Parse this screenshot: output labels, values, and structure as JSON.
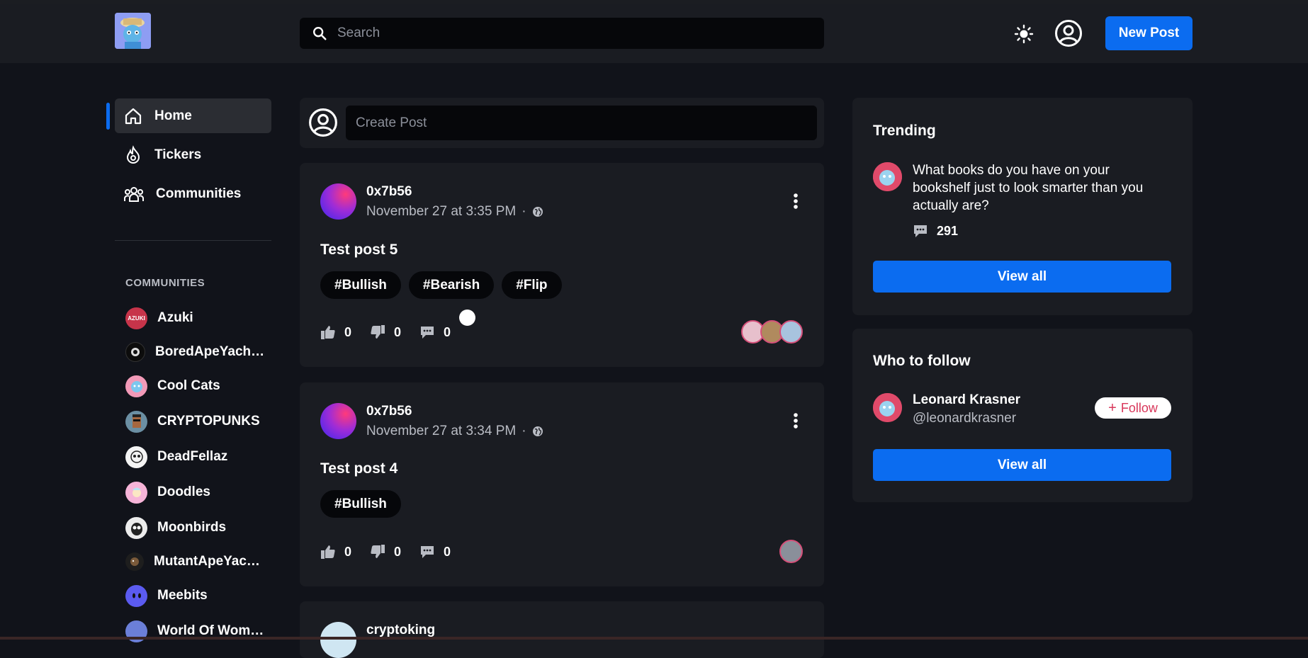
{
  "header": {
    "search_placeholder": "Search",
    "new_post_label": "New Post"
  },
  "nav": {
    "items": [
      {
        "label": "Home",
        "icon": "home-icon",
        "active": true
      },
      {
        "label": "Tickers",
        "icon": "fire-icon"
      },
      {
        "label": "Communities",
        "icon": "people-icon"
      }
    ],
    "communities_heading": "COMMUNITIES",
    "communities": [
      {
        "label": "Azuki",
        "badge": "AZUKI"
      },
      {
        "label": "BoredApeYacht…"
      },
      {
        "label": "Cool Cats"
      },
      {
        "label": "CRYPTOPUNKS"
      },
      {
        "label": "DeadFellaz"
      },
      {
        "label": "Doodles"
      },
      {
        "label": "Moonbirds"
      },
      {
        "label": "MutantApeYacht…"
      },
      {
        "label": "Meebits"
      },
      {
        "label": "World Of Wom…"
      }
    ]
  },
  "feed": {
    "create_placeholder": "Create Post",
    "posts": [
      {
        "author": "0x7b56",
        "time": "November 27 at 3:35 PM",
        "separator": "·",
        "title": "Test post 5",
        "tags": [
          "#Bullish",
          "#Bearish",
          "#Flip"
        ],
        "likes": "0",
        "dislikes": "0",
        "comments": "0"
      },
      {
        "author": "0x7b56",
        "time": "November 27 at 3:34 PM",
        "separator": "·",
        "title": "Test post 4",
        "tags": [
          "#Bullish"
        ],
        "likes": "0",
        "dislikes": "0",
        "comments": "0"
      },
      {
        "author": "cryptoking"
      }
    ]
  },
  "trending": {
    "title": "Trending",
    "item_text": "What books do you have on your bookshelf just to look smarter than you actually are?",
    "item_comments": "291",
    "view_all": "View all"
  },
  "who_to_follow": {
    "title": "Who to follow",
    "name": "Leonard Krasner",
    "handle": "@leonardkrasner",
    "follow_label": "Follow",
    "view_all": "View all"
  },
  "colors": {
    "accent": "#0b6cf0",
    "background": "#11131a",
    "card": "#1a1c22",
    "follow_text": "#d8365a"
  }
}
